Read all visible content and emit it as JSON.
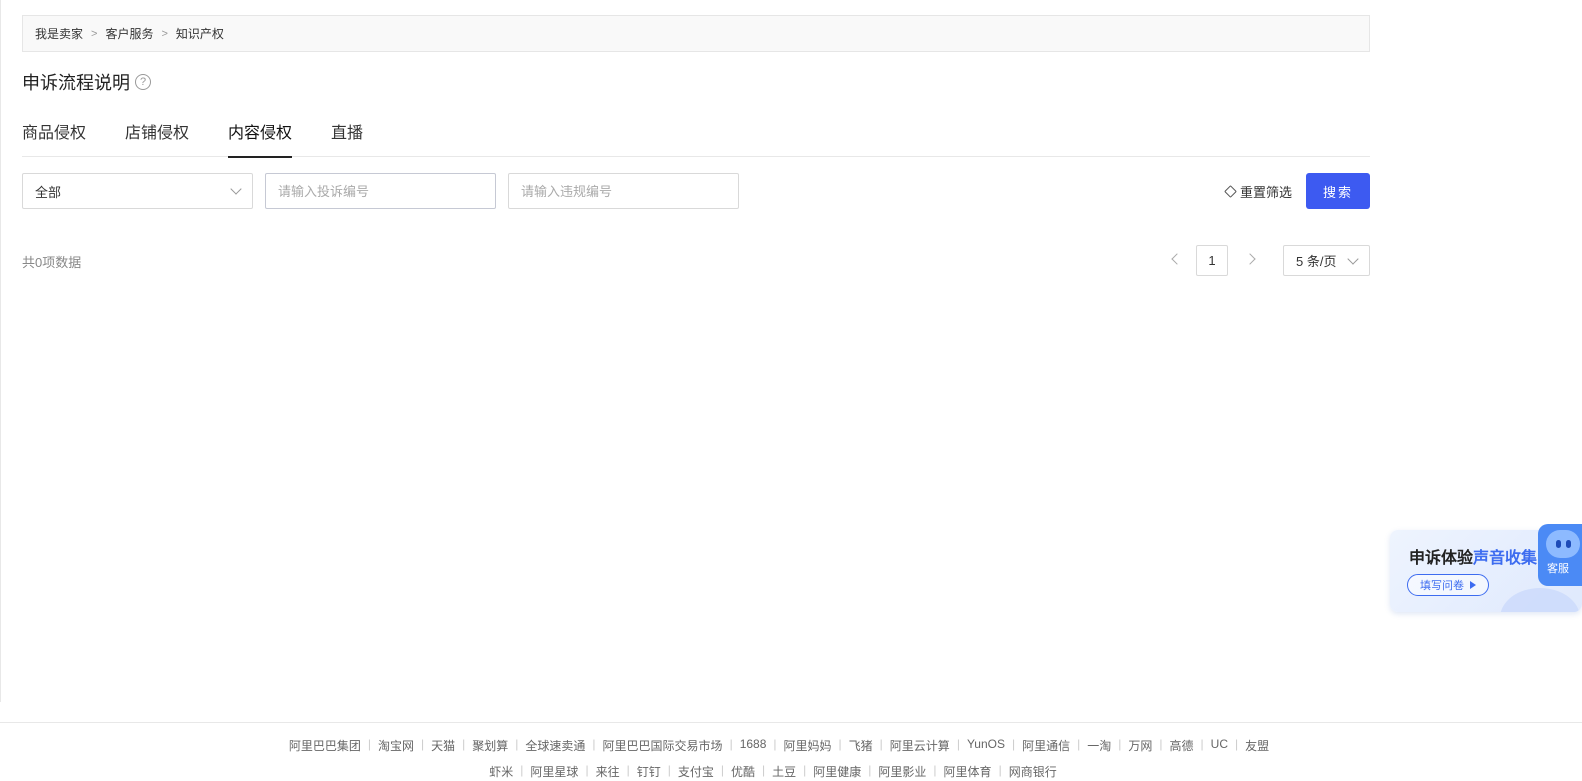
{
  "breadcrumb": [
    "我是卖家",
    "客户服务",
    "知识产权"
  ],
  "breadcrumb_sep": ">",
  "page_title": "申诉流程说明",
  "help_icon_glyph": "?",
  "tabs": [
    {
      "label": "商品侵权",
      "active": false
    },
    {
      "label": "店铺侵权",
      "active": false
    },
    {
      "label": "内容侵权",
      "active": true
    },
    {
      "label": "直播",
      "active": false
    }
  ],
  "filters": {
    "status_select": "全部",
    "complaint_placeholder": "请输入投诉编号",
    "violation_placeholder": "请输入违规编号",
    "reset_label": "重置筛选",
    "search_label": "搜索"
  },
  "result_count": "共0项数据",
  "pagination": {
    "current_page": "1",
    "page_size": "5 条/页"
  },
  "banner": {
    "title_prefix": "申诉体验",
    "title_highlight": "声音收集",
    "button_label": "填写问卷"
  },
  "customer_service": {
    "label": "客服"
  },
  "footer": {
    "row1": [
      "阿里巴巴集团",
      "淘宝网",
      "天猫",
      "聚划算",
      "全球速卖通",
      "阿里巴巴国际交易市场",
      "1688",
      "阿里妈妈",
      "飞猪",
      "阿里云计算",
      "YunOS",
      "阿里通信",
      "一淘",
      "万网",
      "高德",
      "UC",
      "友盟"
    ],
    "row2": [
      "虾米",
      "阿里星球",
      "来往",
      "钉钉",
      "支付宝",
      "优酷",
      "土豆",
      "阿里健康",
      "阿里影业",
      "阿里体育",
      "网商银行"
    ]
  },
  "colors": {
    "primary": "#3d5af1",
    "banner_accent": "#3d6cf0",
    "widget": "#4b8af5"
  },
  "icons": [
    "help-icon",
    "chevron-down-icon",
    "eraser-icon",
    "chevron-left-icon",
    "chevron-right-icon",
    "play-icon",
    "robot-icon"
  ]
}
